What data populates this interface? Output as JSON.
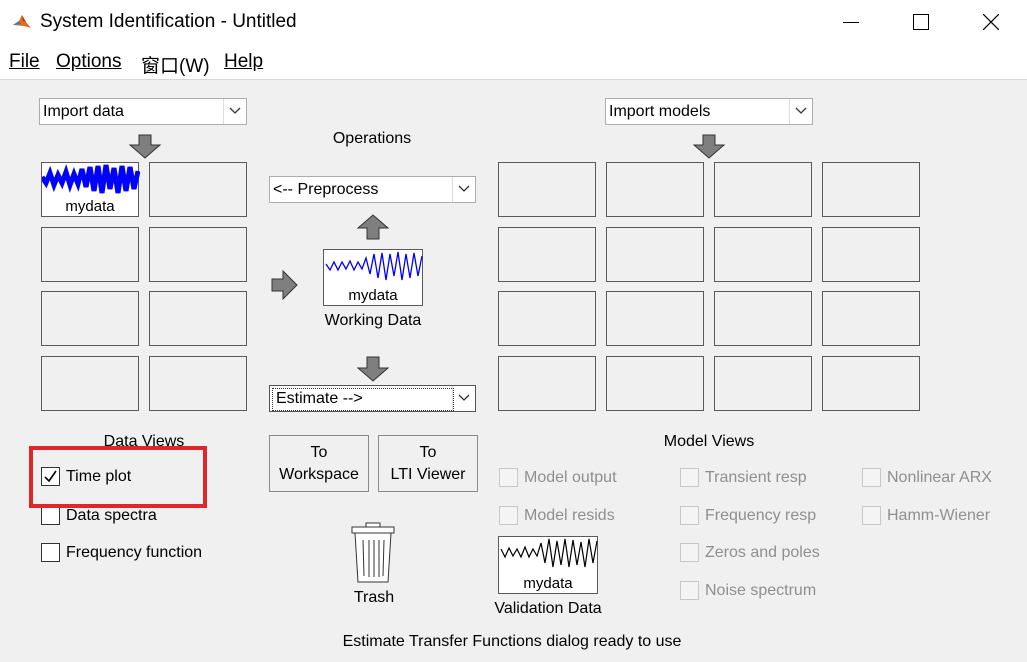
{
  "window": {
    "title": "System Identification - Untitled",
    "controls": [
      "minimize",
      "maximize",
      "close"
    ]
  },
  "menubar": {
    "items": [
      {
        "label": "File",
        "mnemonic": "F"
      },
      {
        "label": "Options",
        "mnemonic": "O"
      },
      {
        "label": "窗口(W)",
        "mnemonic": "W"
      },
      {
        "label": "Help",
        "mnemonic": "H"
      }
    ]
  },
  "data_board": {
    "import_select": "Import data",
    "slots": [
      {
        "label": "mydata",
        "plot_color": "#0000ff"
      }
    ],
    "views_title": "Data Views",
    "views": [
      {
        "label": "Time plot",
        "checked": true
      },
      {
        "label": "Data spectra",
        "checked": false
      },
      {
        "label": "Frequency function",
        "checked": false
      }
    ]
  },
  "operations": {
    "title": "Operations",
    "preprocess_select": "<-- Preprocess",
    "working_data": {
      "label": "mydata",
      "caption": "Working Data"
    },
    "estimate_select": "Estimate -->",
    "to_workspace": "To\nWorkspace",
    "to_lti_viewer": "To\nLTI Viewer",
    "trash_label": "Trash"
  },
  "model_board": {
    "import_select": "Import models",
    "views_title": "Model Views",
    "views": [
      {
        "label": "Model output",
        "enabled": false
      },
      {
        "label": "Transient resp",
        "enabled": false
      },
      {
        "label": "Nonlinear ARX",
        "enabled": false
      },
      {
        "label": "Model resids",
        "enabled": false
      },
      {
        "label": "Frequency resp",
        "enabled": false
      },
      {
        "label": "Hamm-Wiener",
        "enabled": false
      },
      {
        "label": "Zeros and poles",
        "enabled": false
      },
      {
        "label": "Noise spectrum",
        "enabled": false
      }
    ],
    "validation_data": {
      "label": "mydata",
      "caption": "Validation Data"
    }
  },
  "status": "Estimate Transfer Functions dialog ready to use",
  "colors": {
    "highlight": "#e0262b",
    "signal": "#0000ff"
  }
}
